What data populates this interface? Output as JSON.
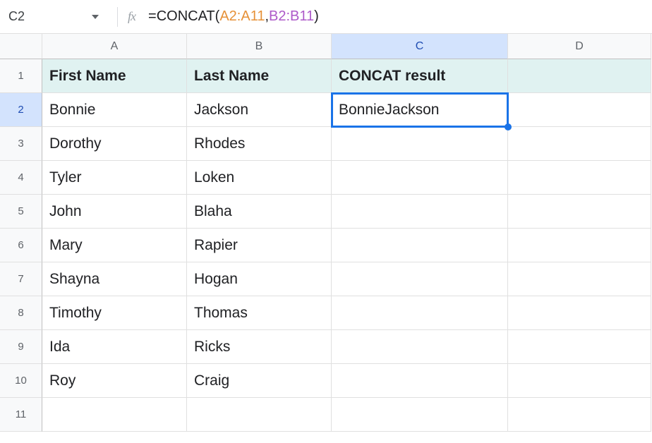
{
  "nameBox": "C2",
  "fxLabel": "fx",
  "formula": {
    "eq": "=",
    "fn": "CONCAT",
    "open": "(",
    "range1": "A2:A11",
    "comma": ",",
    "range2": "B2:B11",
    "close": ")"
  },
  "columns": [
    "A",
    "B",
    "C",
    "D"
  ],
  "activeCol": "C",
  "activeRow": "2",
  "rows": [
    {
      "n": "1",
      "a": "First Name",
      "b": "Last Name",
      "c": "CONCAT result",
      "d": "",
      "header": true
    },
    {
      "n": "2",
      "a": "Bonnie",
      "b": "Jackson",
      "c": "BonnieJackson",
      "d": "",
      "selected": true
    },
    {
      "n": "3",
      "a": "Dorothy",
      "b": "Rhodes",
      "c": "",
      "d": ""
    },
    {
      "n": "4",
      "a": "Tyler",
      "b": "Loken",
      "c": "",
      "d": ""
    },
    {
      "n": "5",
      "a": "John",
      "b": "Blaha",
      "c": "",
      "d": ""
    },
    {
      "n": "6",
      "a": "Mary",
      "b": "Rapier",
      "c": "",
      "d": ""
    },
    {
      "n": "7",
      "a": "Shayna",
      "b": "Hogan",
      "c": "",
      "d": ""
    },
    {
      "n": "8",
      "a": "Timothy",
      "b": "Thomas",
      "c": "",
      "d": ""
    },
    {
      "n": "9",
      "a": "Ida",
      "b": "Ricks",
      "c": "",
      "d": ""
    },
    {
      "n": "10",
      "a": "Roy",
      "b": "Craig",
      "c": "",
      "d": ""
    },
    {
      "n": "11",
      "a": "",
      "b": "",
      "c": "",
      "d": ""
    }
  ]
}
